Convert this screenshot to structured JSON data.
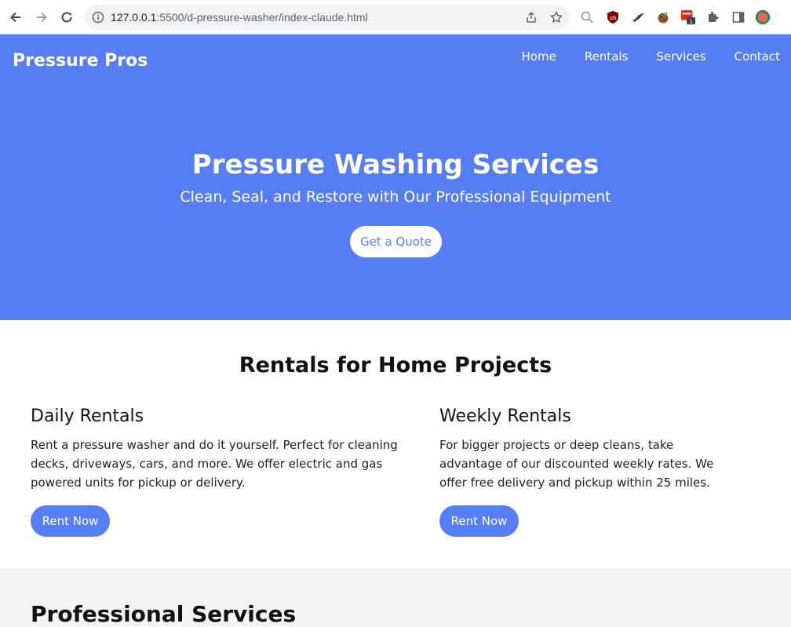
{
  "browser": {
    "url_host": "127.0.0.1",
    "url_rest": ":5500/d-pressure-washer/index-claude.html",
    "icons": [
      "back-icon",
      "forward-icon",
      "reload-icon",
      "info-icon",
      "share-icon",
      "star-icon",
      "search-icon",
      "ublock-icon",
      "extension-bird-icon",
      "extension-cookie-icon",
      "extension-badge-icon",
      "puzzle-icon",
      "sidepanel-icon",
      "profile-icon"
    ],
    "extension_badge_count": "1"
  },
  "header": {
    "brand": "Pressure Pros",
    "menu": [
      {
        "label": "Home"
      },
      {
        "label": "Rentals"
      },
      {
        "label": "Services"
      },
      {
        "label": "Contact"
      }
    ]
  },
  "hero": {
    "title": "Pressure Washing Services",
    "subtitle": "Clean, Seal, and Restore with Our Professional Equipment",
    "cta": "Get a Quote"
  },
  "rentals": {
    "heading": "Rentals for Home Projects",
    "cards": [
      {
        "title": "Daily Rentals",
        "text": "Rent a pressure washer and do it yourself. Perfect for cleaning decks, driveways, cars, and more. We offer electric and gas powered units for pickup or delivery.",
        "button": "Rent Now"
      },
      {
        "title": "Weekly Rentals",
        "text": "For bigger projects or deep cleans, take advantage of our discounted weekly rates. We offer free delivery and pickup within 25 miles.",
        "button": "Rent Now"
      }
    ]
  },
  "services": {
    "heading": "Professional Services"
  },
  "colors": {
    "brand_blue": "#577df3",
    "section_gray": "#f2f3f5"
  }
}
